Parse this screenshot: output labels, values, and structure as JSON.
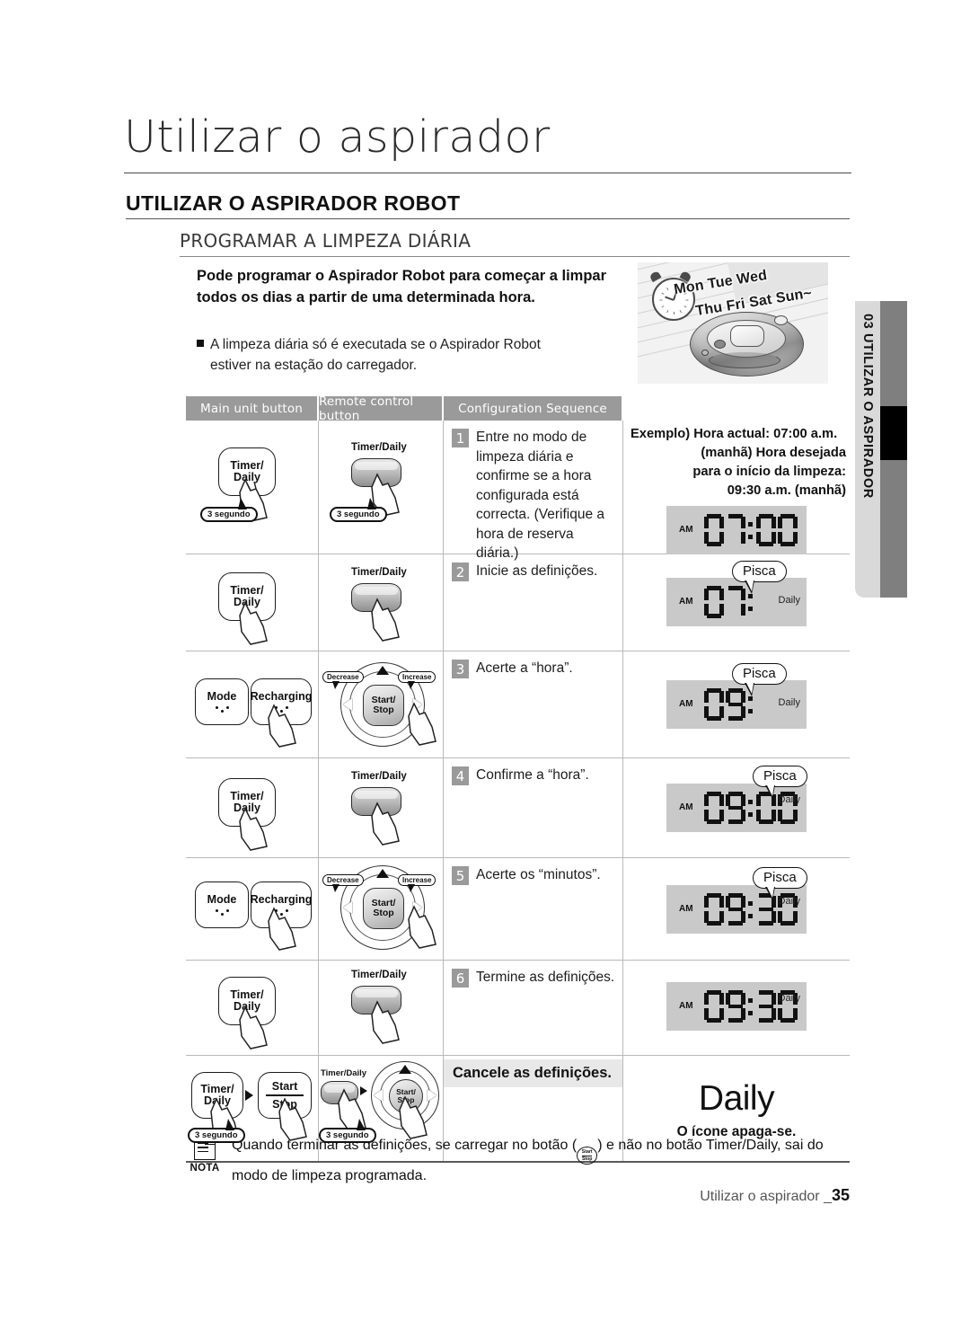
{
  "header": {
    "chapter_title": "Utilizar o aspirador",
    "h1": "UTILIZAR O ASPIRADOR ROBOT",
    "h2": "PROGRAMAR A LIMPEZA DIÁRIA"
  },
  "intro": {
    "bold": "Pode programar o Aspirador Robot para começar a limpar todos os dias a partir de uma determinada hora.",
    "bullet_line1": "A limpeza diária só é executada se o Aspirador Robot",
    "bullet_line2": "estiver na estação do carregador."
  },
  "hero": {
    "days_line1": "Mon Tue Wed",
    "days_line2": "Thu Fri Sat Sun~"
  },
  "side_tab": {
    "number": "03",
    "label": "UTILIZAR O ASPIRADOR",
    "full": "03  UTILIZAR O ASPIRADOR"
  },
  "table": {
    "headers": [
      "Main unit button",
      "Remote control button",
      "Configuration Sequence"
    ],
    "rows": [
      {
        "step": "1",
        "text": "Entre no modo de limpeza diária e confirme se a hora configurada está correcta. (Verifique a hora de reserva diária.)",
        "main_unit": {
          "key_label": "Timer/\nDaily",
          "key_line1": "Timer/",
          "key_line2": "Daily",
          "hold_badge": "3 segundo"
        },
        "remote": {
          "label": "Timer/Daily",
          "hold_badge": "3 segundo"
        },
        "lcd": {
          "am": "AM",
          "hour": "07",
          "minute": "00",
          "daily": "",
          "bubble": "",
          "show_minutes": true
        }
      },
      {
        "step": "2",
        "text": "Inicie as definições.",
        "main_unit": {
          "key_line1": "Timer/",
          "key_line2": "Daily",
          "hold_badge": ""
        },
        "remote": {
          "label": "Timer/Daily",
          "hold_badge": ""
        },
        "lcd": {
          "am": "AM",
          "hour": "07",
          "minute": "",
          "daily": "Daily",
          "bubble": "Pisca",
          "show_minutes": false
        }
      },
      {
        "step": "3",
        "text": "Acerte a “hora”.",
        "main_unit": {
          "key_line1": "Mode",
          "key2_line1": "Recharging",
          "hold_badge": ""
        },
        "remote": {
          "label": "Start/\nStop",
          "decrease": "Decrease",
          "increase": "Increase",
          "hold_badge": ""
        },
        "lcd": {
          "am": "AM",
          "hour": "09",
          "minute": "",
          "daily": "Daily",
          "bubble": "Pisca",
          "show_minutes": false
        }
      },
      {
        "step": "4",
        "text": "Confirme a “hora”.",
        "main_unit": {
          "key_line1": "Timer/",
          "key_line2": "Daily",
          "hold_badge": ""
        },
        "remote": {
          "label": "Timer/Daily",
          "hold_badge": ""
        },
        "lcd": {
          "am": "AM",
          "hour": "09",
          "minute": "00",
          "daily": "Daily",
          "bubble": "Pisca",
          "show_minutes": true
        }
      },
      {
        "step": "5",
        "text": "Acerte os “minutos”.",
        "main_unit": {
          "key_line1": "Mode",
          "key2_line1": "Recharging",
          "hold_badge": ""
        },
        "remote": {
          "label": "Start/\nStop",
          "decrease": "Decrease",
          "increase": "Increase",
          "hold_badge": ""
        },
        "lcd": {
          "am": "AM",
          "hour": "09",
          "minute": "30",
          "daily": "Daily",
          "bubble": "Pisca",
          "show_minutes": true
        }
      },
      {
        "step": "6",
        "text": "Termine as definições.",
        "main_unit": {
          "key_line1": "Timer/",
          "key_line2": "Daily",
          "hold_badge": ""
        },
        "remote": {
          "label": "Timer/Daily",
          "hold_badge": ""
        },
        "lcd": {
          "am": "AM",
          "hour": "09",
          "minute": "30",
          "daily": "Daily",
          "bubble": "",
          "show_minutes": true
        }
      }
    ],
    "cancel_row": {
      "title": "Cancele as definições.",
      "main_unit": {
        "key1_l1": "Timer/",
        "key1_l2": "Daily",
        "key2_l1": "Start",
        "key2_l2": "Stop",
        "hold_badge": "3 segundo"
      },
      "remote": {
        "label": "Timer/Daily",
        "center_l1": "Start/",
        "center_l2": "Stop",
        "hold_badge": "3 segundo"
      },
      "daily_word": "Daily",
      "caption": "O ícone apaga-se."
    },
    "example": {
      "line1": "Exemplo) Hora actual: 07:00 a.m.",
      "line2": "(manhã) Hora desejada",
      "line3": "para o início da limpeza:",
      "line4": "09:30 a.m. (manhã)"
    }
  },
  "note": {
    "tag": "NOTA",
    "text_before": "Quando terminar as definições, se carregar no botão (",
    "inline_button_l1": "Start",
    "inline_button_l2": "Stop",
    "text_after": ") e não no botão Timer/Daily, sai do modo de limpeza programada."
  },
  "footer": {
    "label": "Utilizar o aspirador  _",
    "page": "35"
  },
  "colors": {
    "header_gray": "#9a9a9a",
    "lcd_gray": "#c9c9c9",
    "cancel_bg": "#e8e8e8",
    "tab_light": "#d9d9d9",
    "tab_dark": "#7f7f7f"
  }
}
